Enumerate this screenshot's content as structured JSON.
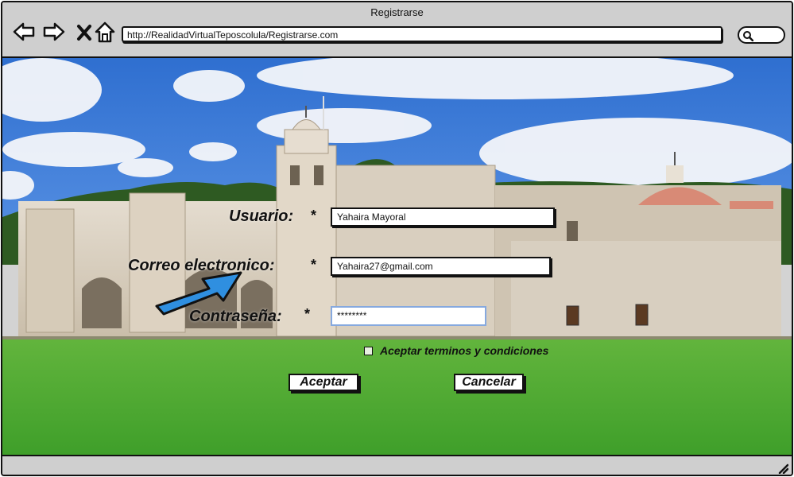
{
  "window": {
    "title": "Registrarse",
    "url": "http://RealidadVirtualTeposcolula/Registrarse.com"
  },
  "form": {
    "usuario_label": "Usuario:",
    "usuario_value": "Yahaira Mayoral",
    "correo_label": "Correo electronico:",
    "correo_value": "Yahaira27@gmail.com",
    "contrasena_label": "Contraseña:",
    "contrasena_value": "********",
    "required_mark": "*",
    "terms_label": "Aceptar terminos y condiciones",
    "terms_checked": false
  },
  "buttons": {
    "aceptar": "Aceptar",
    "cancelar": "Cancelar"
  },
  "icons": [
    "back-arrow-icon",
    "forward-arrow-icon",
    "close-x-icon",
    "home-icon",
    "search-icon",
    "resize-grip-icon",
    "pointer-arrow-icon"
  ],
  "colors": {
    "sky": "#3f7fd8",
    "grass": "#4aa631",
    "stone": "#d8cfc2",
    "dome": "#d88a76",
    "arrow": "#2f8fe0",
    "active_field_border": "#86a9df"
  }
}
